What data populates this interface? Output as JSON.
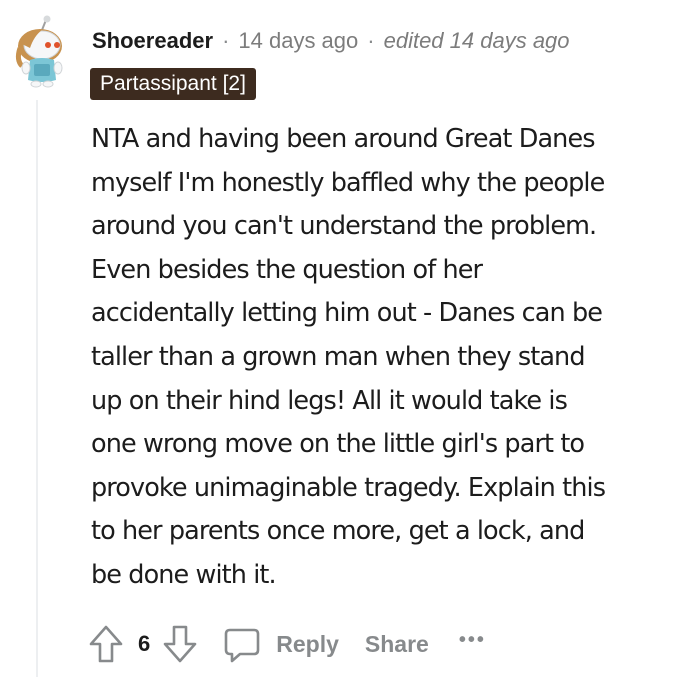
{
  "comment": {
    "author": "Shoereader",
    "separator": "·",
    "time": "14 days ago",
    "edited": "edited 14 days ago",
    "flair": "Partassipant [2]",
    "body_lines": [
      "NTA and having been around Great Danes",
      "myself I'm honestly baffled why the people",
      "around you can't understand the problem.",
      "Even besides the question of her",
      "accidentally letting him out - Danes can be",
      "taller than a grown man when they stand",
      "up on their hind legs! All it would take is",
      "one wrong move on the little girl's part to",
      "provoke unimaginable tragedy. Explain this",
      "to her parents once more, get a lock, and",
      "be done with it."
    ]
  },
  "actions": {
    "score": "6",
    "reply_label": "Reply",
    "share_label": "Share",
    "more_label": "•••"
  },
  "colors": {
    "flair_bg": "#3d2b1f",
    "muted": "#878a8c",
    "text": "#1c1c1c"
  },
  "icons": {
    "avatar": "snoo-avatar",
    "upvote": "upvote-arrow-icon",
    "downvote": "downvote-arrow-icon",
    "reply": "speech-bubble-icon",
    "more": "ellipsis-icon"
  }
}
